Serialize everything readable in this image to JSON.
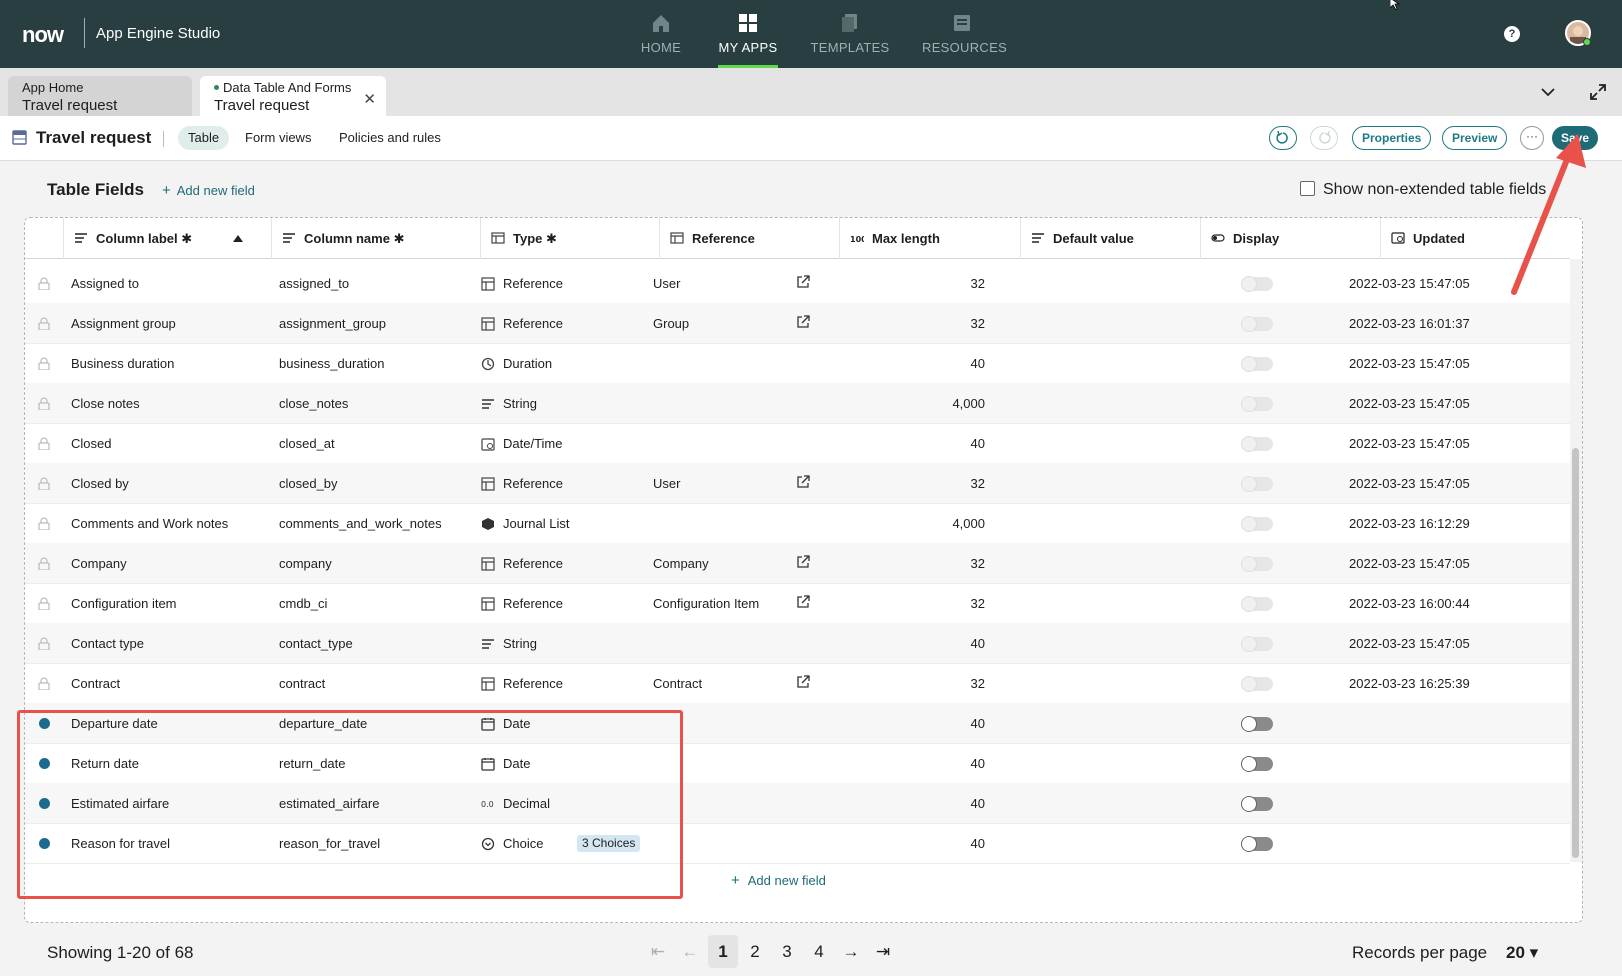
{
  "app": {
    "logo": "now",
    "studio_name": "App Engine Studio"
  },
  "topnav": {
    "items": [
      {
        "label": "HOME",
        "icon": "home-icon",
        "active": false
      },
      {
        "label": "MY APPS",
        "icon": "grid-icon",
        "active": true
      },
      {
        "label": "TEMPLATES",
        "icon": "templates-icon",
        "active": false
      },
      {
        "label": "RESOURCES",
        "icon": "resources-icon",
        "active": false
      }
    ],
    "help": "?"
  },
  "tabs": [
    {
      "title": "App Home",
      "subtitle": "Travel request",
      "active": false
    },
    {
      "title": "Data Table And Forms",
      "subtitle": "Travel request",
      "active": true,
      "close": "✕"
    }
  ],
  "toolbar": {
    "title": "Travel request",
    "tabs": [
      "Table",
      "Form views",
      "Policies and rules"
    ],
    "properties": "Properties",
    "preview": "Preview",
    "more": "···",
    "save": "Save"
  },
  "panel": {
    "title": "Table Fields",
    "add_field": "Add new field",
    "show_non_extended": "Show non-extended table fields"
  },
  "table": {
    "headers": [
      "Column label ✱",
      "Column name ✱",
      "Type ✱",
      "Reference",
      "Max length",
      "Default value",
      "Display",
      "Updated"
    ],
    "rows": [
      {
        "label": "Assigned to",
        "name": "assigned_to",
        "type": "Reference",
        "type_icon": "reference-icon",
        "reference": "User",
        "ext": true,
        "max": "32",
        "default": "",
        "display_on": false,
        "updated": "2022-03-23 15:47:05",
        "new": false
      },
      {
        "label": "Assignment group",
        "name": "assignment_group",
        "type": "Reference",
        "type_icon": "reference-icon",
        "reference": "Group",
        "ext": true,
        "max": "32",
        "default": "",
        "display_on": false,
        "updated": "2022-03-23 16:01:37",
        "new": false
      },
      {
        "label": "Business duration",
        "name": "business_duration",
        "type": "Duration",
        "type_icon": "duration-icon",
        "reference": "",
        "ext": false,
        "max": "40",
        "default": "",
        "display_on": false,
        "updated": "2022-03-23 15:47:05",
        "new": false
      },
      {
        "label": "Close notes",
        "name": "close_notes",
        "type": "String",
        "type_icon": "string-icon",
        "reference": "",
        "ext": false,
        "max": "4,000",
        "default": "",
        "display_on": false,
        "updated": "2022-03-23 15:47:05",
        "new": false
      },
      {
        "label": "Closed",
        "name": "closed_at",
        "type": "Date/Time",
        "type_icon": "datetime-icon",
        "reference": "",
        "ext": false,
        "max": "40",
        "default": "",
        "display_on": false,
        "updated": "2022-03-23 15:47:05",
        "new": false
      },
      {
        "label": "Closed by",
        "name": "closed_by",
        "type": "Reference",
        "type_icon": "reference-icon",
        "reference": "User",
        "ext": true,
        "max": "32",
        "default": "",
        "display_on": false,
        "updated": "2022-03-23 15:47:05",
        "new": false
      },
      {
        "label": "Comments and Work notes",
        "name": "comments_and_work_notes",
        "type": "Journal List",
        "type_icon": "journal-icon",
        "reference": "",
        "ext": false,
        "max": "4,000",
        "default": "",
        "display_on": false,
        "updated": "2022-03-23 16:12:29",
        "new": false
      },
      {
        "label": "Company",
        "name": "company",
        "type": "Reference",
        "type_icon": "reference-icon",
        "reference": "Company",
        "ext": true,
        "max": "32",
        "default": "",
        "display_on": false,
        "updated": "2022-03-23 15:47:05",
        "new": false
      },
      {
        "label": "Configuration item",
        "name": "cmdb_ci",
        "type": "Reference",
        "type_icon": "reference-icon",
        "reference": "Configuration Item",
        "ext": true,
        "max": "32",
        "default": "",
        "display_on": false,
        "updated": "2022-03-23 16:00:44",
        "new": false
      },
      {
        "label": "Contact type",
        "name": "contact_type",
        "type": "String",
        "type_icon": "string-icon",
        "reference": "",
        "ext": false,
        "max": "40",
        "default": "",
        "display_on": false,
        "updated": "2022-03-23 15:47:05",
        "new": false
      },
      {
        "label": "Contract",
        "name": "contract",
        "type": "Reference",
        "type_icon": "reference-icon",
        "reference": "Contract",
        "ext": true,
        "max": "32",
        "default": "",
        "display_on": false,
        "updated": "2022-03-23 16:25:39",
        "new": false
      },
      {
        "label": "Departure date",
        "name": "departure_date",
        "type": "Date",
        "type_icon": "date-icon",
        "reference": "",
        "ext": false,
        "max": "40",
        "default": "",
        "display_on": true,
        "updated": "",
        "new": true
      },
      {
        "label": "Return date",
        "name": "return_date",
        "type": "Date",
        "type_icon": "date-icon",
        "reference": "",
        "ext": false,
        "max": "40",
        "default": "",
        "display_on": true,
        "updated": "",
        "new": true
      },
      {
        "label": "Estimated airfare",
        "name": "estimated_airfare",
        "type": "Decimal",
        "type_icon": "decimal-icon",
        "reference": "",
        "ext": false,
        "max": "40",
        "default": "",
        "display_on": true,
        "updated": "",
        "new": true
      },
      {
        "label": "Reason for travel",
        "name": "reason_for_travel",
        "type": "Choice",
        "type_icon": "choice-icon",
        "badge": "3 Choices",
        "reference": "",
        "ext": false,
        "max": "40",
        "default": "",
        "display_on": true,
        "updated": "",
        "new": true
      }
    ]
  },
  "footer": {
    "showing": "Showing 1-20 of 68",
    "pages": [
      "1",
      "2",
      "3",
      "4"
    ],
    "current_page": "1",
    "records_per_page_label": "Records per page",
    "records_per_page": "20 ▾"
  },
  "colors": {
    "nav_bg": "#293e40",
    "accent": "#1f6b75",
    "highlight": "#e8524a",
    "new_dot": "#1c6b8e",
    "active_underline": "#62d84e"
  }
}
